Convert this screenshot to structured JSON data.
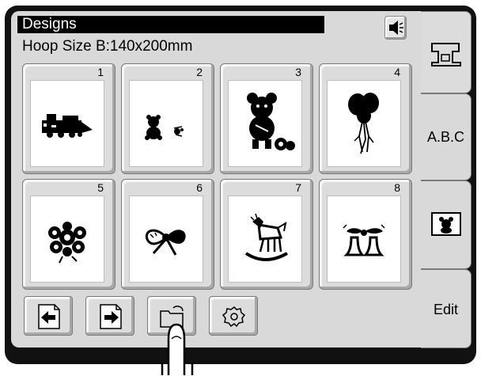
{
  "header": {
    "title": "Designs",
    "hoop_size": "Hoop Size B:140x200mm"
  },
  "icons": {
    "speaker": "speaker-icon",
    "machine": "sewing-machine-icon",
    "teddy": "teddy-bear-icon",
    "prev": "arrow-left-icon",
    "next": "arrow-right-icon",
    "folder": "folder-icon",
    "settings": "gear-icon"
  },
  "designs": [
    {
      "number": "1",
      "motif": "train"
    },
    {
      "number": "2",
      "motif": "teddy-bears"
    },
    {
      "number": "3",
      "motif": "teddy-bear-with-toy"
    },
    {
      "number": "4",
      "motif": "balloons"
    },
    {
      "number": "5",
      "motif": "flower-bouquet"
    },
    {
      "number": "6",
      "motif": "bow"
    },
    {
      "number": "7",
      "motif": "rocking-horse"
    },
    {
      "number": "8",
      "motif": "wedding-bells"
    }
  ],
  "side_tabs": {
    "abc": "A.B.C",
    "edit": "Edit"
  },
  "colors": {
    "panel": "#d9d9d9",
    "frame": "#111111",
    "title_bg": "#000000",
    "title_fg": "#ffffff"
  }
}
